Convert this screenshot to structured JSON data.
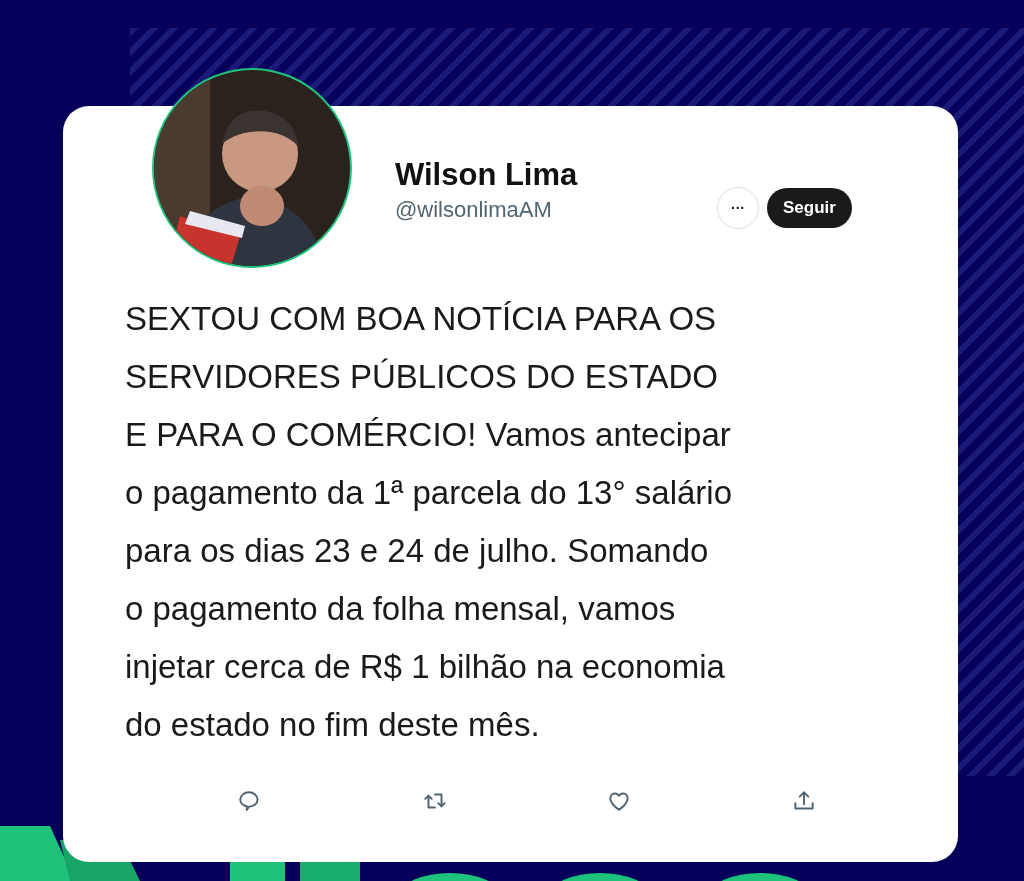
{
  "tweet": {
    "author": {
      "name": "Wilson Lima",
      "handle": "@wilsonlimaAM"
    },
    "more_button": "···",
    "follow_button": "Seguir",
    "text": "SEXTOU COM BOA NOTÍCIA PARA OS\nSERVIDORES PÚBLICOS DO ESTADO\nE PARA O COMÉRCIO! Vamos antecipar\no pagamento da 1ª parcela do 13° salário\npara os dias 23 e 24 de julho. Somando\no pagamento da folha mensal, vamos\ninjetar cerca de R$ 1 bilhão na economia\ndo estado no fim deste mês.",
    "actions": [
      {
        "kind": "reply"
      },
      {
        "kind": "retweet"
      },
      {
        "kind": "like"
      },
      {
        "kind": "share"
      }
    ]
  }
}
